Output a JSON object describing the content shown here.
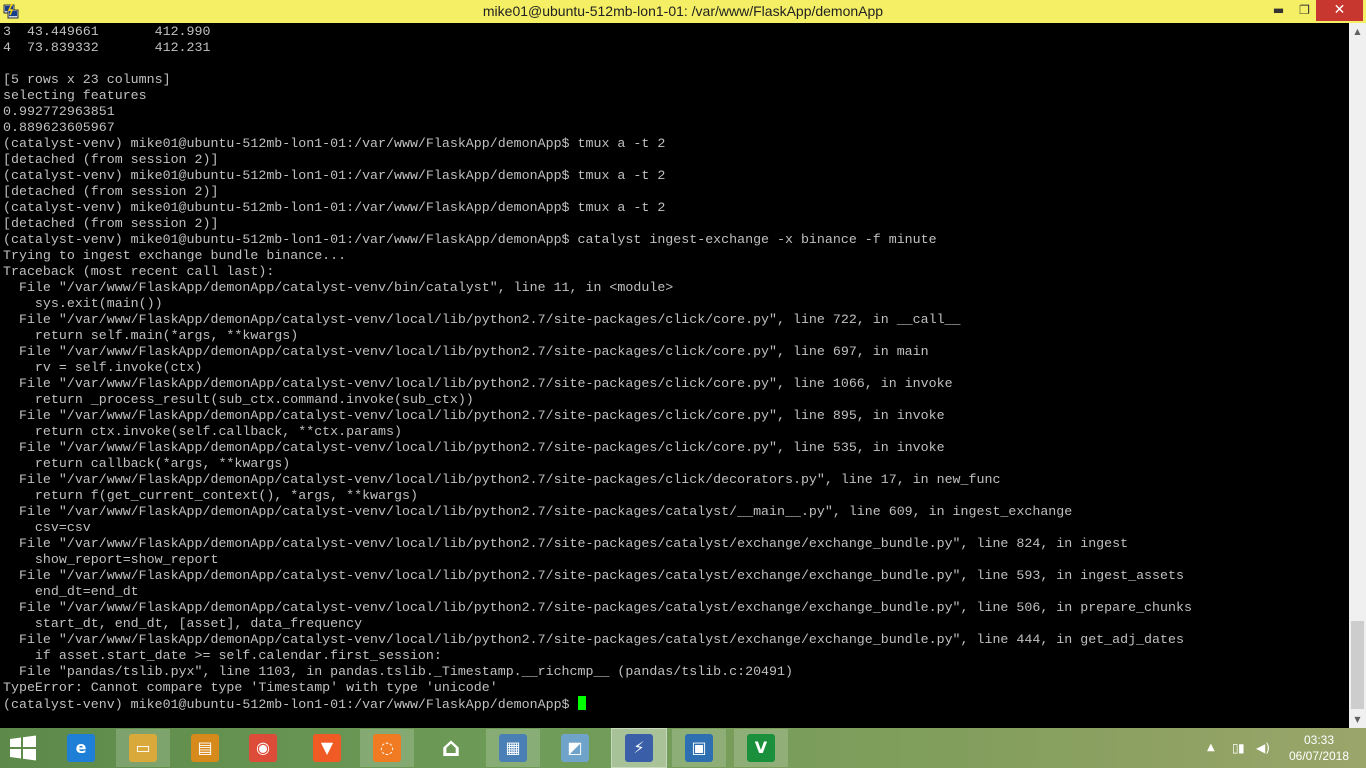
{
  "window": {
    "title": "mike01@ubuntu-512mb-lon1-01: /var/www/FlaskApp/demonApp",
    "icon": "putty-icon",
    "minimize_glyph": "▬",
    "maximize_glyph": "❐",
    "close_glyph": "✕"
  },
  "terminal": {
    "lines": [
      "3  43.449661       412.990",
      "4  73.839332       412.231",
      "",
      "[5 rows x 23 columns]",
      "selecting features",
      "0.992772963851",
      "0.889623605967",
      "(catalyst-venv) mike01@ubuntu-512mb-lon1-01:/var/www/FlaskApp/demonApp$ tmux a -t 2",
      "[detached (from session 2)]",
      "(catalyst-venv) mike01@ubuntu-512mb-lon1-01:/var/www/FlaskApp/demonApp$ tmux a -t 2",
      "[detached (from session 2)]",
      "(catalyst-venv) mike01@ubuntu-512mb-lon1-01:/var/www/FlaskApp/demonApp$ tmux a -t 2",
      "[detached (from session 2)]",
      "(catalyst-venv) mike01@ubuntu-512mb-lon1-01:/var/www/FlaskApp/demonApp$ catalyst ingest-exchange -x binance -f minute",
      "Trying to ingest exchange bundle binance...",
      "Traceback (most recent call last):",
      "  File \"/var/www/FlaskApp/demonApp/catalyst-venv/bin/catalyst\", line 11, in <module>",
      "    sys.exit(main())",
      "  File \"/var/www/FlaskApp/demonApp/catalyst-venv/local/lib/python2.7/site-packages/click/core.py\", line 722, in __call__",
      "    return self.main(*args, **kwargs)",
      "  File \"/var/www/FlaskApp/demonApp/catalyst-venv/local/lib/python2.7/site-packages/click/core.py\", line 697, in main",
      "    rv = self.invoke(ctx)",
      "  File \"/var/www/FlaskApp/demonApp/catalyst-venv/local/lib/python2.7/site-packages/click/core.py\", line 1066, in invoke",
      "    return _process_result(sub_ctx.command.invoke(sub_ctx))",
      "  File \"/var/www/FlaskApp/demonApp/catalyst-venv/local/lib/python2.7/site-packages/click/core.py\", line 895, in invoke",
      "    return ctx.invoke(self.callback, **ctx.params)",
      "  File \"/var/www/FlaskApp/demonApp/catalyst-venv/local/lib/python2.7/site-packages/click/core.py\", line 535, in invoke",
      "    return callback(*args, **kwargs)",
      "  File \"/var/www/FlaskApp/demonApp/catalyst-venv/local/lib/python2.7/site-packages/click/decorators.py\", line 17, in new_func",
      "    return f(get_current_context(), *args, **kwargs)",
      "  File \"/var/www/FlaskApp/demonApp/catalyst-venv/local/lib/python2.7/site-packages/catalyst/__main__.py\", line 609, in ingest_exchange",
      "    csv=csv",
      "  File \"/var/www/FlaskApp/demonApp/catalyst-venv/local/lib/python2.7/site-packages/catalyst/exchange/exchange_bundle.py\", line 824, in ingest",
      "    show_report=show_report",
      "  File \"/var/www/FlaskApp/demonApp/catalyst-venv/local/lib/python2.7/site-packages/catalyst/exchange/exchange_bundle.py\", line 593, in ingest_assets",
      "    end_dt=end_dt",
      "  File \"/var/www/FlaskApp/demonApp/catalyst-venv/local/lib/python2.7/site-packages/catalyst/exchange/exchange_bundle.py\", line 506, in prepare_chunks",
      "    start_dt, end_dt, [asset], data_frequency",
      "  File \"/var/www/FlaskApp/demonApp/catalyst-venv/local/lib/python2.7/site-packages/catalyst/exchange/exchange_bundle.py\", line 444, in get_adj_dates",
      "    if asset.start_date >= self.calendar.first_session:",
      "  File \"pandas/tslib.pyx\", line 1103, in pandas.tslib._Timestamp.__richcmp__ (pandas/tslib.c:20491)",
      "TypeError: Cannot compare type 'Timestamp' with type 'unicode'"
    ],
    "prompt": "(catalyst-venv) mike01@ubuntu-512mb-lon1-01:/var/www/FlaskApp/demonApp$ ",
    "cursor_color": "#00ff00"
  },
  "scrollbar": {
    "up_glyph": "▲",
    "down_glyph": "▼"
  },
  "taskbar": {
    "items": [
      {
        "icon": "internet-explorer-icon",
        "glyph": "e",
        "color": "#1f7fd6",
        "state": "normal"
      },
      {
        "icon": "file-explorer-icon",
        "glyph": "▭",
        "color": "#d9a93b",
        "state": "open"
      },
      {
        "icon": "notes-app-icon",
        "glyph": "▤",
        "color": "#d78a1c",
        "state": "normal"
      },
      {
        "icon": "chrome-icon",
        "glyph": "◉",
        "color": "#dd4b39",
        "state": "normal"
      },
      {
        "icon": "brave-icon",
        "glyph": "▼",
        "color": "#f05a24",
        "state": "normal"
      },
      {
        "icon": "swift-app-icon",
        "glyph": "◌",
        "color": "#f07b23",
        "state": "open"
      },
      {
        "icon": "home-icon",
        "glyph": "⌂",
        "color": "#ffffff",
        "state": "normal"
      },
      {
        "icon": "calculator-icon",
        "glyph": "▦",
        "color": "#4a7fb5",
        "state": "open"
      },
      {
        "icon": "notepad-icon",
        "glyph": "◩",
        "color": "#6fa3c9",
        "state": "normal"
      },
      {
        "icon": "putty-icon",
        "glyph": "⚡",
        "color": "#3a5fa8",
        "state": "active"
      },
      {
        "icon": "remote-desktop-icon",
        "glyph": "▣",
        "color": "#2d6fb0",
        "state": "open"
      },
      {
        "icon": "vim-icon",
        "glyph": "V",
        "color": "#1a8f3c",
        "state": "open"
      }
    ],
    "tray": {
      "up_glyph": "▲",
      "flag_glyph": "▯",
      "signal_glyph": "▮",
      "volume_glyph": "◀)",
      "time": "03:33",
      "date": "06/07/2018"
    }
  }
}
